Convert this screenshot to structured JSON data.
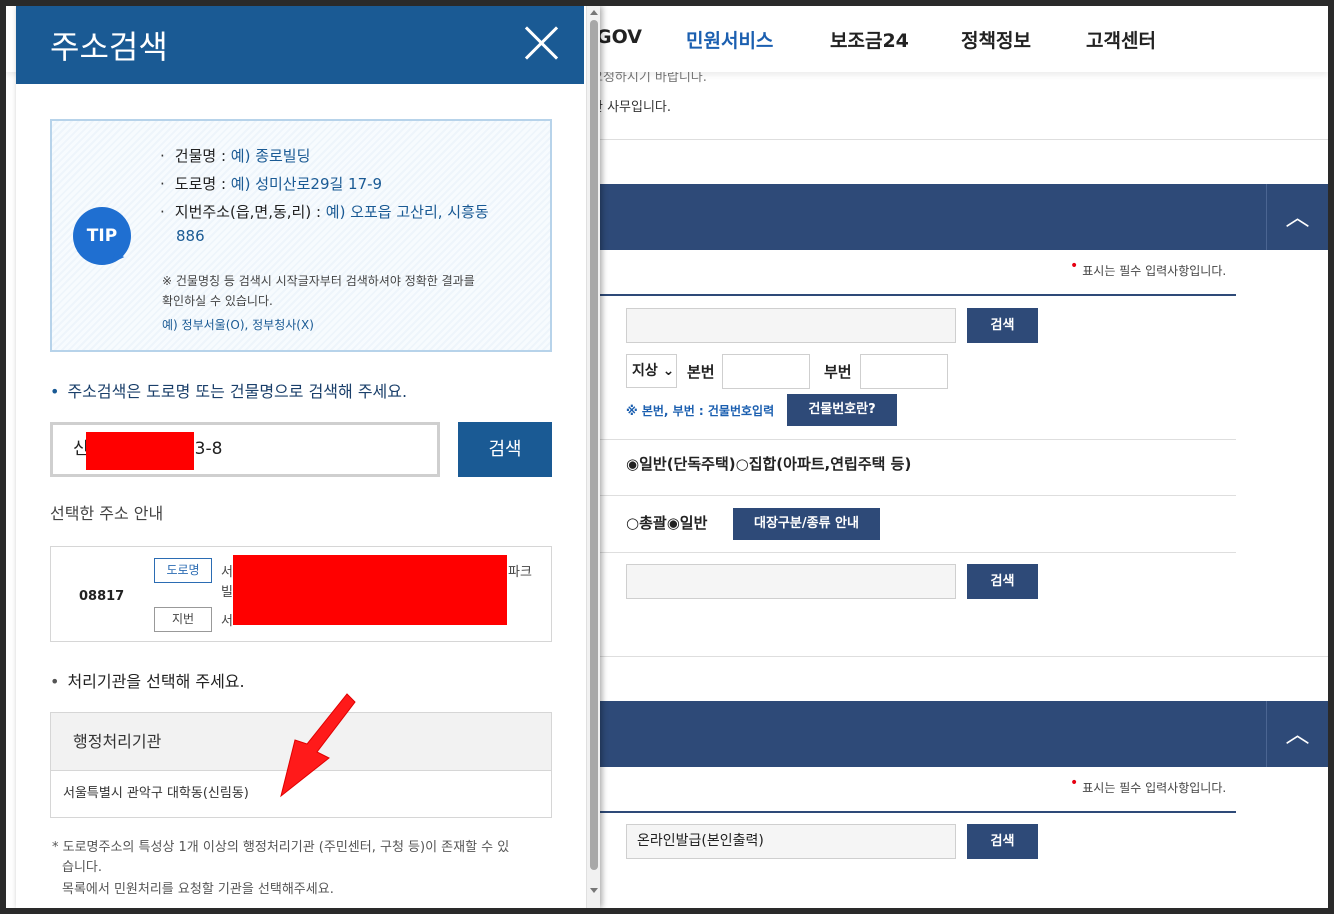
{
  "nav": {
    "items": [
      "GOV",
      "민원서비스",
      "보조금24",
      "정책정보",
      "고객센터"
    ],
    "active_index": 1
  },
  "bg": {
    "text_line1": "요청하시기 바랍니다.",
    "text_line2": "관 사무입니다.",
    "required_note": "표시는 필수 입력사항입니다.",
    "search_label": "검색",
    "jisang": "지상",
    "bonbeon": "본번",
    "bubeon": "부번",
    "bonbeon_note": "※ 본번, 부번 : 건물번호입력",
    "building_no_btn": "건물번호란?",
    "radio_general": "일반(단독주택)",
    "radio_collective": "집합(아파트,연립주택 등)",
    "radio_total": "총괄",
    "radio_general2": "일반",
    "ledger_btn": "대장구분/종류 안내",
    "online_issue": "온라인발급(본인출력)",
    "toggle_icon": "chevron-up-icon"
  },
  "popup": {
    "title": "주소검색",
    "close_icon": "close-icon",
    "tip": {
      "badge": "TIP",
      "lines": [
        {
          "label": "건물명 : ",
          "example": "예) 종로빌딩"
        },
        {
          "label": "도로명 : ",
          "example": "예) 성미산로29길 17-9"
        },
        {
          "label": "지번주소(읍,면,동,리) : ",
          "example": "예) 오포읍 고산리, 시흥동"
        }
      ],
      "line3_cont": "886",
      "note_line1": "※ 건물명칭 등 검색시 시작글자부터 검색하셔야 정확한 결과를",
      "note_line2": "확인하실 수 있습니다.",
      "example2": "예) 정부서울(O), 정부청사(X)"
    },
    "guide_search": "주소검색은 도로명 또는 건물명으로 검색해 주세요.",
    "search_value_prefix": "신",
    "search_value_suffix": "3-8",
    "search_button": "검색",
    "selected_label": "선택한 주소 안내",
    "zipcode": "08817",
    "tag_road": "도로명",
    "tag_jibun": "지번",
    "addr_road_prefix": "서",
    "addr_road_suffix": "파크",
    "addr_road_line2": "빌",
    "addr_jibun_prefix": "서",
    "org_guide": "처리기관을 선택해 주세요.",
    "org_header": "행정처리기관",
    "org_value": "서울특별시 관악구 대학동(신림동)",
    "footnote_line1": "* 도로명주소의 특성상 1개 이상의 행정처리기관 (주민센터, 구청 등)이 존재할 수 있",
    "footnote_line2": "습니다.",
    "footnote_line3": "목록에서 민원처리를 요청할 기관을 선택해주세요."
  },
  "colors": {
    "header_blue": "#1a5a94",
    "section_navy": "#2e4a78",
    "redaction": "#ff0000",
    "annotation_arrow": "#ff0000"
  }
}
